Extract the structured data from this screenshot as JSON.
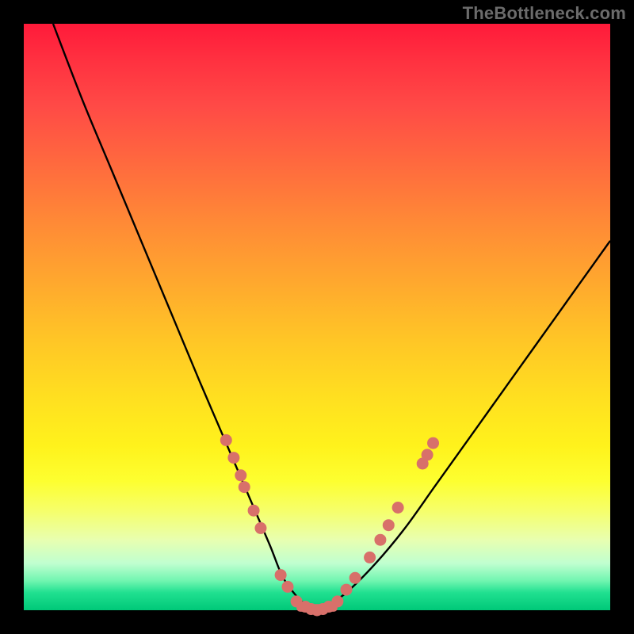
{
  "watermark": "TheBottleneck.com",
  "chart_data": {
    "type": "line",
    "title": "",
    "xlabel": "",
    "ylabel": "",
    "xlim": [
      0,
      100
    ],
    "ylim": [
      0,
      100
    ],
    "grid": false,
    "legend": false,
    "series": [
      {
        "name": "bottleneck-curve",
        "x": [
          5,
          10,
          15,
          20,
          25,
          30,
          33,
          36,
          39,
          42,
          44,
          46,
          48,
          50,
          52,
          55,
          60,
          65,
          70,
          75,
          80,
          85,
          90,
          95,
          100
        ],
        "y": [
          100,
          87,
          75,
          63,
          51,
          39,
          32,
          25,
          18,
          11,
          6,
          3,
          1,
          0,
          1,
          3,
          8,
          14,
          21,
          28,
          35,
          42,
          49,
          56,
          63
        ],
        "color": "#000000"
      }
    ],
    "markers": {
      "name": "highlight-dots",
      "color": "#d8706a",
      "points": [
        {
          "x": 34.5,
          "y": 29
        },
        {
          "x": 35.8,
          "y": 26
        },
        {
          "x": 37.0,
          "y": 23
        },
        {
          "x": 37.6,
          "y": 21
        },
        {
          "x": 39.2,
          "y": 17
        },
        {
          "x": 40.4,
          "y": 14
        },
        {
          "x": 43.8,
          "y": 6
        },
        {
          "x": 45.0,
          "y": 4
        },
        {
          "x": 46.5,
          "y": 1.5
        },
        {
          "x": 48.0,
          "y": 0.6
        },
        {
          "x": 49.0,
          "y": 0.2
        },
        {
          "x": 50.0,
          "y": 0
        },
        {
          "x": 51.0,
          "y": 0.2
        },
        {
          "x": 52.0,
          "y": 0.6
        },
        {
          "x": 53.5,
          "y": 1.5
        },
        {
          "x": 55.0,
          "y": 3.5
        },
        {
          "x": 56.5,
          "y": 5.5
        },
        {
          "x": 59.0,
          "y": 9
        },
        {
          "x": 60.8,
          "y": 12
        },
        {
          "x": 62.2,
          "y": 14.5
        },
        {
          "x": 63.8,
          "y": 17.5
        },
        {
          "x": 68.0,
          "y": 25
        },
        {
          "x": 68.8,
          "y": 26.5
        },
        {
          "x": 69.8,
          "y": 28.5
        }
      ]
    },
    "flat_floor": {
      "name": "curve-floor-bar",
      "color": "#d8706a",
      "x_start": 46.5,
      "x_end": 53.5,
      "y": 0.4,
      "height_frac": 0.013
    },
    "gradient_stops": [
      {
        "pos": 0.0,
        "color": "#ff1a3a"
      },
      {
        "pos": 0.25,
        "color": "#ff7a38"
      },
      {
        "pos": 0.55,
        "color": "#ffd222"
      },
      {
        "pos": 0.8,
        "color": "#fcff40"
      },
      {
        "pos": 0.93,
        "color": "#a0ffc8"
      },
      {
        "pos": 1.0,
        "color": "#00c878"
      }
    ]
  }
}
